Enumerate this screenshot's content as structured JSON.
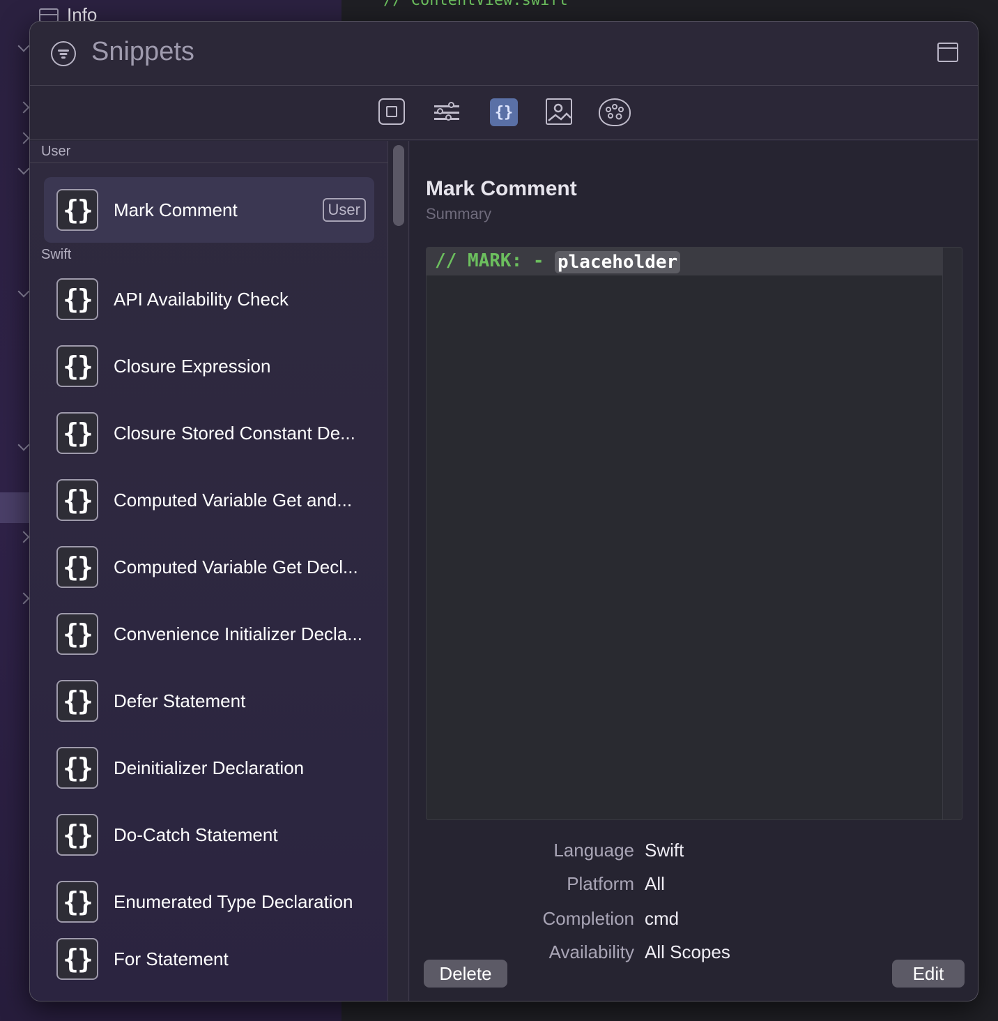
{
  "background": {
    "sidebar_info_label": "Info",
    "editor_code_line": "//  ContentView.swift"
  },
  "window": {
    "title": "Snippets",
    "title_icon": "filter-circle-icon",
    "layout_icon": "window-layout-icon"
  },
  "toolbar": {
    "buttons": [
      {
        "icon": "square-icon",
        "selected": false
      },
      {
        "icon": "sliders-icon",
        "selected": false
      },
      {
        "icon": "braces-icon",
        "selected": true,
        "glyph": "{}"
      },
      {
        "icon": "image-icon",
        "selected": false
      },
      {
        "icon": "palette-icon",
        "selected": false
      }
    ]
  },
  "list": {
    "sections": [
      {
        "header": "User",
        "items": [
          {
            "label": "Mark Comment",
            "badge": "User",
            "selected": true
          }
        ]
      },
      {
        "header": "Swift",
        "items": [
          {
            "label": "API Availability Check"
          },
          {
            "label": "Closure Expression"
          },
          {
            "label": "Closure Stored Constant De..."
          },
          {
            "label": "Computed Variable Get and..."
          },
          {
            "label": "Computed Variable Get Decl..."
          },
          {
            "label": "Convenience Initializer Decla..."
          },
          {
            "label": "Defer Statement"
          },
          {
            "label": "Deinitializer Declaration"
          },
          {
            "label": "Do-Catch Statement"
          },
          {
            "label": "Enumerated Type Declaration"
          },
          {
            "label": "For Statement"
          }
        ]
      }
    ],
    "item_icon_glyph": "{}"
  },
  "detail": {
    "title": "Mark Comment",
    "summary": "Summary",
    "code": {
      "prefix": "// MARK: - ",
      "placeholder": "placeholder"
    },
    "meta": [
      {
        "label": "Language",
        "value": "Swift"
      },
      {
        "label": "Platform",
        "value": "All"
      },
      {
        "label": "Completion",
        "value": "cmd"
      },
      {
        "label": "Availability",
        "value": "All Scopes"
      }
    ],
    "delete_label": "Delete",
    "edit_label": "Edit"
  },
  "colors": {
    "accent_selected": "#5a70a6",
    "code_comment": "#6cbf5e",
    "panel_bg": "#2a2738"
  }
}
